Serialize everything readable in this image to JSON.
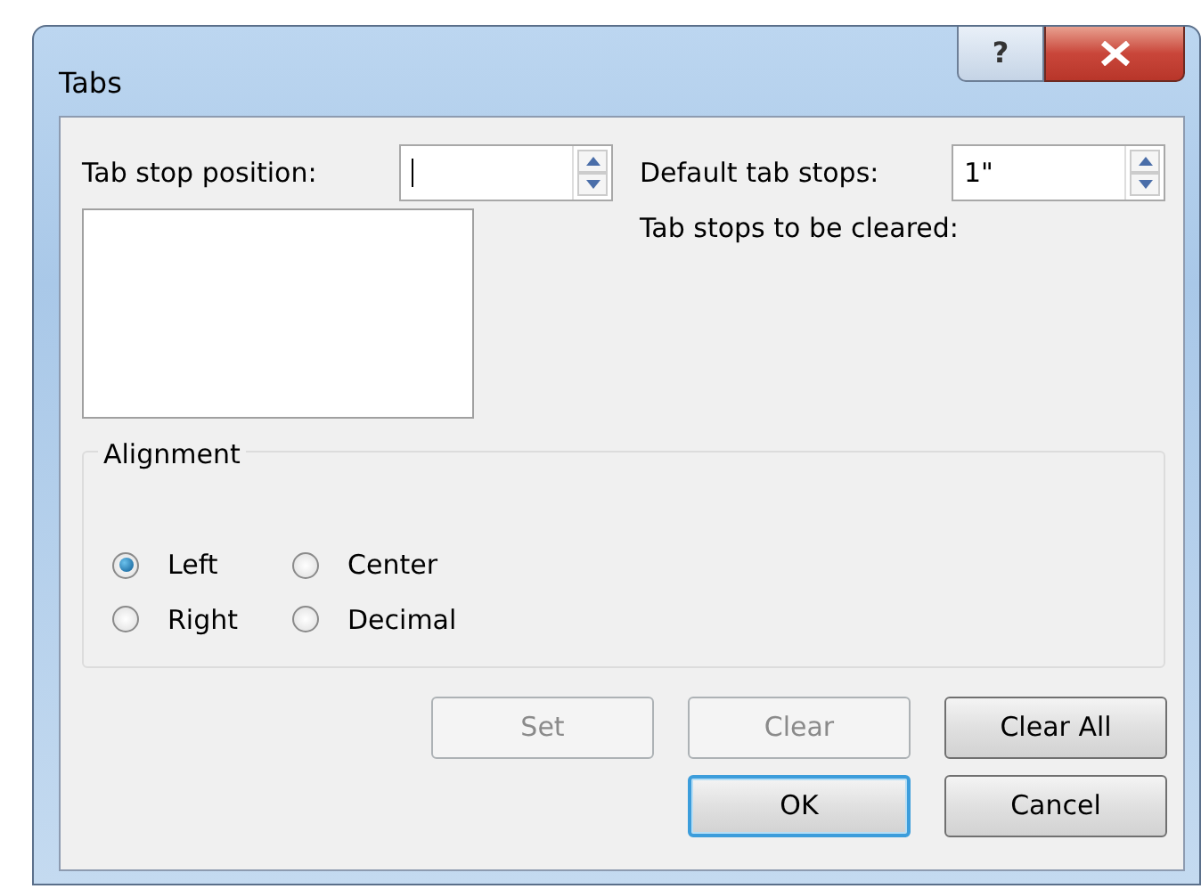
{
  "window": {
    "title": "Tabs",
    "help": "?"
  },
  "tab_stop_position": {
    "label": "Tab stop position:"
  },
  "default_tab_stops": {
    "label": "Default tab stops:",
    "value": "1\""
  },
  "tab_stops_to_be_cleared": {
    "label": "Tab stops to be cleared:"
  },
  "alignment": {
    "title": "Alignment",
    "options": [
      {
        "label": "Left",
        "selected": true
      },
      {
        "label": "Center",
        "selected": false
      },
      {
        "label": "Right",
        "selected": false
      },
      {
        "label": "Decimal",
        "selected": false
      }
    ]
  },
  "buttons": [
    {
      "label": "Set",
      "disabled": true,
      "default": false
    },
    {
      "label": "Clear",
      "disabled": true,
      "default": false
    },
    {
      "label": "Clear All",
      "disabled": false,
      "default": false
    },
    {
      "label": "OK",
      "disabled": false,
      "default": true
    },
    {
      "label": "Cancel",
      "disabled": false,
      "default": false
    }
  ]
}
